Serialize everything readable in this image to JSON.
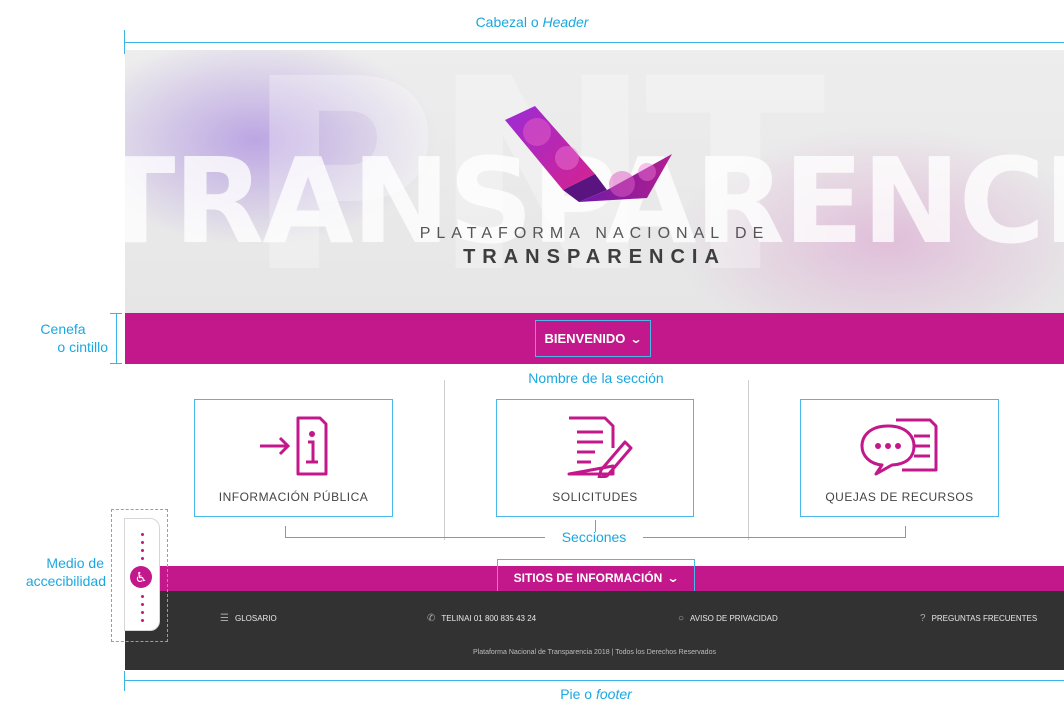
{
  "annotations": {
    "header_pre": "Cabezal o ",
    "header_em": "Header",
    "cenefa_l1": "Cenefa",
    "cenefa_l2": "o cintillo",
    "section_name": "Nombre de la sección",
    "sections": "Secciones",
    "accessibility_l1": "Medio de",
    "accessibility_l2": "accecibilidad",
    "footer_pre": "Pie o ",
    "footer_em": "footer"
  },
  "header": {
    "bg_word": "TRANSPARENCIA",
    "bg_letters": "PNT",
    "logo_line1": "PLATAFORMA NACIONAL DE",
    "logo_line2": "TRANSPARENCIA"
  },
  "nav": {
    "welcome_label": "BIENVENIDO"
  },
  "sections": [
    {
      "label": "INFORMACIÓN PÚBLICA",
      "icon": "info-document-icon"
    },
    {
      "label": "SOLICITUDES",
      "icon": "document-pencil-icon"
    },
    {
      "label": "QUEJAS DE RECURSOS",
      "icon": "chat-document-icon"
    }
  ],
  "footer": {
    "sites_label": "SITIOS DE INFORMACIÓN",
    "links": [
      {
        "label": "GLOSARIO",
        "icon": "glossary-icon"
      },
      {
        "label": "TELINAI 01 800 835 43 24",
        "icon": "phone-icon"
      },
      {
        "label": "AVISO DE PRIVACIDAD",
        "icon": "lock-icon"
      },
      {
        "label": "PREGUNTAS FRECUENTES",
        "icon": "question-icon"
      }
    ],
    "copyright": "Plataforma Nacional de Transparencia 2018  |  Todos los Derechos Reservados"
  },
  "accessibility": {
    "icon": "wheelchair-icon"
  },
  "colors": {
    "brand_magenta": "#c2188b",
    "annotation_blue": "#1ba8e0",
    "footer_dark": "#323232"
  }
}
